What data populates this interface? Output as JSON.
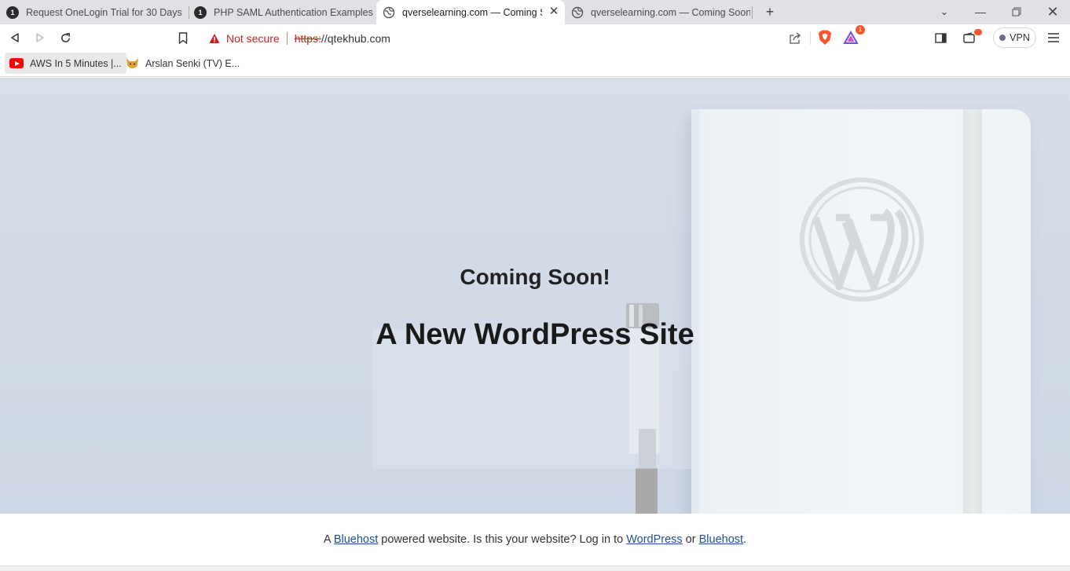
{
  "tabs": [
    {
      "title": "Request OneLogin Trial for 30 Days",
      "favicon": "onelogin-icon",
      "badge": "1",
      "active": false
    },
    {
      "title": "PHP SAML Authentication Examples | ",
      "favicon": "onelogin-icon",
      "badge": "1",
      "active": false
    },
    {
      "title": "qverselearning.com — Coming S",
      "favicon": "globe-icon",
      "active": true
    },
    {
      "title": "qverselearning.com — Coming Soon",
      "favicon": "globe-icon",
      "active": false
    }
  ],
  "toolbar": {
    "security_label": "Not secure",
    "url_scheme": "https:",
    "url_rest": "//qtekhub.com",
    "vpn_label": "VPN",
    "rewards_badge": "1"
  },
  "bookmarks": [
    {
      "label": "AWS In 5 Minutes |...",
      "icon": "youtube-icon"
    },
    {
      "label": "Arslan Senki (TV) E...",
      "icon": "cat-icon"
    }
  ],
  "page": {
    "coming_soon": "Coming Soon!",
    "site_title": "A New WordPress Site"
  },
  "footer": {
    "prefix": "A ",
    "link1": "Bluehost",
    "middle": " powered website. Is this your website? Log in to ",
    "link2": "WordPress",
    "or": " or ",
    "link3": "Bluehost",
    "suffix": "."
  },
  "colors": {
    "insecure": "#c5221f",
    "link": "#1e4f9c",
    "brave_orange": "#fb542b"
  }
}
